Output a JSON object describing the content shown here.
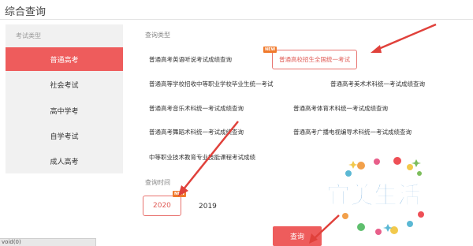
{
  "page": {
    "title": "综合查询"
  },
  "sidebar": {
    "header": "考试类型",
    "items": [
      {
        "label": "普通高考",
        "active": true
      },
      {
        "label": "社会考试",
        "active": false
      },
      {
        "label": "高中学考",
        "active": false
      },
      {
        "label": "自学考试",
        "active": false
      },
      {
        "label": "成人高考",
        "active": false
      }
    ]
  },
  "query_type": {
    "label": "查询类型",
    "new_badge": "NEW",
    "items": [
      {
        "label": "普通高考英语听说考试成绩查询"
      },
      {
        "label": "普通高校招生全国统一考试",
        "selected": true
      },
      {
        "label": "普通高等学校招收中等职业学校毕业生统一考试"
      },
      {
        "label": "普通高考美术术科统一考试成绩查询"
      },
      {
        "label": "普通高考音乐术科统一考试成绩查询"
      },
      {
        "label": "普通高考体育术科统一考试成绩查询"
      },
      {
        "label": "普通高考舞蹈术科统一考试成绩查询"
      },
      {
        "label": "普通高考广播电视编导术科统一考试成绩查询"
      },
      {
        "label": "中等职业技术教育专业技能课程考试成绩"
      }
    ]
  },
  "query_time": {
    "label": "查询时间",
    "new_badge": "NEW",
    "years": [
      {
        "label": "2020",
        "selected": true
      },
      {
        "label": "2019",
        "selected": false
      }
    ]
  },
  "actions": {
    "query_label": "查询"
  },
  "status_bar": {
    "text": "void(0)"
  },
  "watermark": {
    "text": "宜美生活"
  },
  "colors": {
    "accent": "#ee5c5c",
    "badge": "#f07a2c",
    "sidebar_bg": "#f1f1f1"
  }
}
